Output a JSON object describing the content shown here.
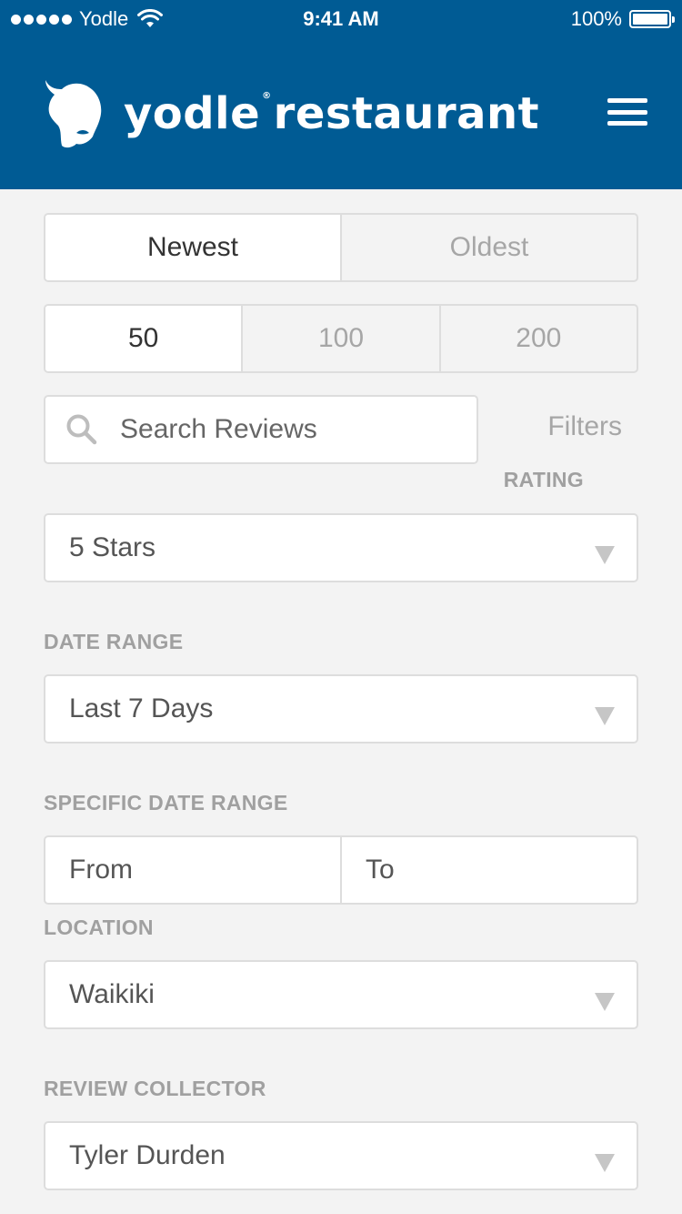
{
  "status_bar": {
    "carrier": "Yodle",
    "time": "9:41 AM",
    "battery": "100%"
  },
  "header": {
    "brand_primary": "yodle",
    "brand_secondary": "restaurant",
    "registered_mark": "®",
    "background_color": "#005b94"
  },
  "sort": {
    "options": [
      "Newest",
      "Oldest"
    ],
    "selected": "Newest"
  },
  "count": {
    "options": [
      "50",
      "100",
      "200"
    ],
    "selected": "50"
  },
  "search": {
    "placeholder": "Search Reviews"
  },
  "filters_label": "Filters",
  "rating": {
    "label": "RATING",
    "value": "5 Stars"
  },
  "date_range": {
    "label": "DATE RANGE",
    "value": "Last 7 Days"
  },
  "specific_date_range": {
    "label": "SPECIFIC DATE RANGE",
    "from": "From",
    "to": "To"
  },
  "location": {
    "label": "LOCATION",
    "value": "Waikiki"
  },
  "review_collector": {
    "label": "REVIEW COLLECTOR",
    "value": "Tyler Durden"
  }
}
